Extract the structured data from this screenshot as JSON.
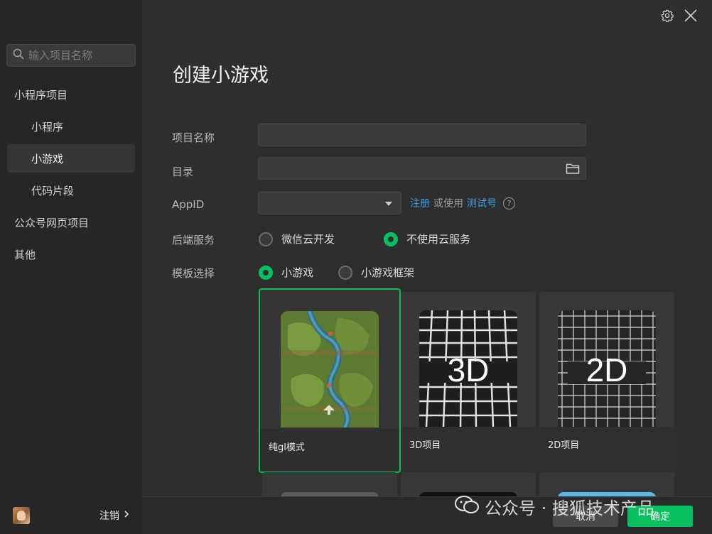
{
  "sidebar": {
    "search_placeholder": "输入项目名称",
    "items": [
      {
        "label": "小程序项目",
        "level": 1
      },
      {
        "label": "小程序",
        "level": 2
      },
      {
        "label": "小游戏",
        "level": 2,
        "active": true
      },
      {
        "label": "代码片段",
        "level": 2
      },
      {
        "label": "公众号网页项目",
        "level": 1
      },
      {
        "label": "其他",
        "level": 1
      }
    ],
    "logout_label": "注销"
  },
  "page": {
    "title": "创建小游戏"
  },
  "form": {
    "project_name_label": "项目名称",
    "project_name_value": "",
    "directory_label": "目录",
    "directory_value": "",
    "appid_label": "AppID",
    "appid_value": "",
    "register_link": "注册",
    "or_use_text": "或使用",
    "test_account_link": "测试号",
    "backend_label": "后端服务",
    "backend_options": [
      {
        "label": "微信云开发",
        "selected": false
      },
      {
        "label": "不使用云服务",
        "selected": true
      }
    ],
    "template_label": "模板选择",
    "template_options": [
      {
        "label": "小游戏",
        "selected": true
      },
      {
        "label": "小游戏框架",
        "selected": false
      }
    ]
  },
  "templates": [
    {
      "caption": "纯gl模式",
      "selected": true
    },
    {
      "caption": "3D项目",
      "thumb_text": "3D",
      "selected": false
    },
    {
      "caption": "2D项目",
      "thumb_text": "2D",
      "selected": false
    }
  ],
  "footer": {
    "cancel_label": "取消",
    "confirm_label": "确定"
  },
  "watermark": {
    "text": "公众号 · 搜狐技术产品"
  },
  "colors": {
    "accent": "#07c160",
    "link": "#3d9ee5"
  }
}
